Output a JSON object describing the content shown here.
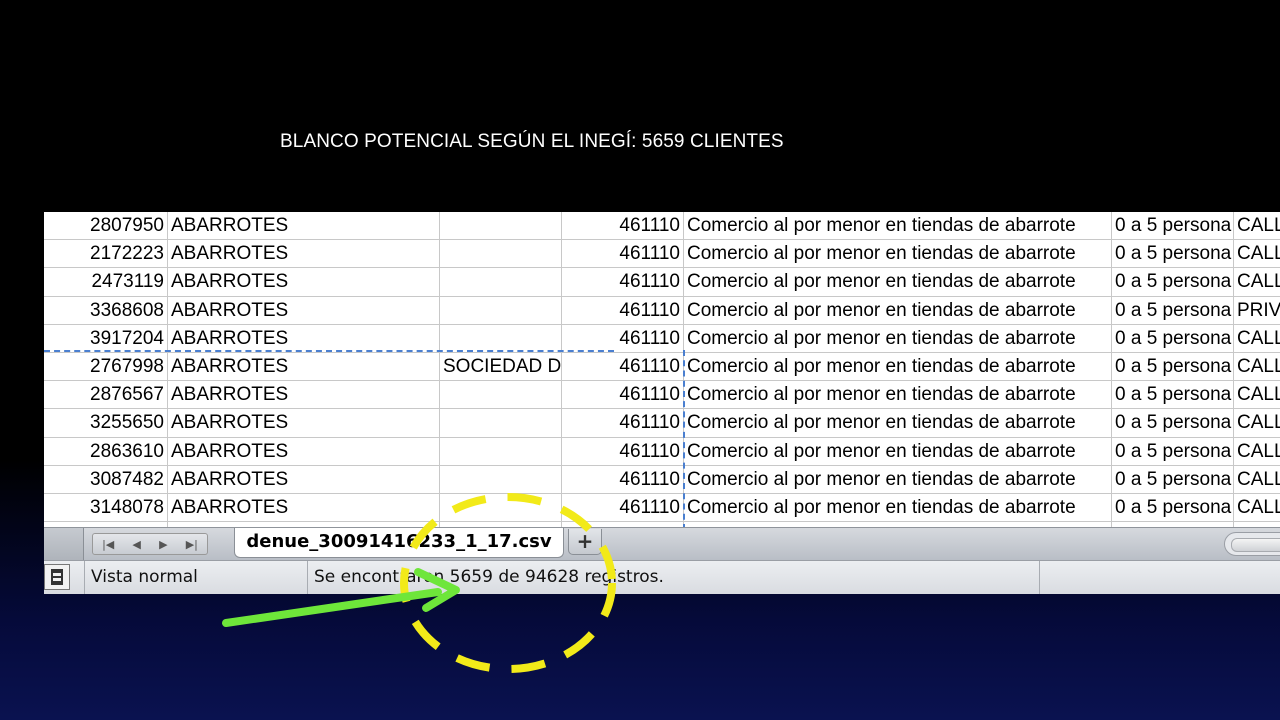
{
  "slide": {
    "title": "BLANCO POTENCIAL SEGÚN EL INEGÍ: 5659 CLIENTES"
  },
  "spreadsheet": {
    "rows": [
      {
        "id": "2807950",
        "name": "ABARROTES",
        "company": "",
        "code": "461110",
        "activity": "Comercio al por menor en tiendas de abarrote",
        "employees": "0 a 5 persona",
        "road": "CALL"
      },
      {
        "id": "2172223",
        "name": "ABARROTES",
        "company": "",
        "code": "461110",
        "activity": "Comercio al por menor en tiendas de abarrote",
        "employees": "0 a 5 persona",
        "road": "CALL"
      },
      {
        "id": "2473119",
        "name": "ABARROTES",
        "company": "",
        "code": "461110",
        "activity": "Comercio al por menor en tiendas de abarrote",
        "employees": "0 a 5 persona",
        "road": "CALL"
      },
      {
        "id": "3368608",
        "name": "ABARROTES",
        "company": "",
        "code": "461110",
        "activity": "Comercio al por menor en tiendas de abarrote",
        "employees": "0 a 5 persona",
        "road": "PRIV"
      },
      {
        "id": "3917204",
        "name": "ABARROTES",
        "company": "",
        "code": "461110",
        "activity": "Comercio al por menor en tiendas de abarrote",
        "employees": "0 a 5 persona",
        "road": "CALL"
      },
      {
        "id": "2767998",
        "name": "ABARROTES",
        "company": "SOCIEDAD DI",
        "code": "461110",
        "activity": "Comercio al por menor en tiendas de abarrote",
        "employees": "0 a 5 persona",
        "road": "CALL"
      },
      {
        "id": "2876567",
        "name": "ABARROTES",
        "company": "",
        "code": "461110",
        "activity": "Comercio al por menor en tiendas de abarrote",
        "employees": "0 a 5 persona",
        "road": "CALL"
      },
      {
        "id": "3255650",
        "name": "ABARROTES",
        "company": "",
        "code": "461110",
        "activity": "Comercio al por menor en tiendas de abarrote",
        "employees": "0 a 5 persona",
        "road": "CALL"
      },
      {
        "id": "2863610",
        "name": "ABARROTES",
        "company": "",
        "code": "461110",
        "activity": "Comercio al por menor en tiendas de abarrote",
        "employees": "0 a 5 persona",
        "road": "CALL"
      },
      {
        "id": "3087482",
        "name": "ABARROTES",
        "company": "",
        "code": "461110",
        "activity": "Comercio al por menor en tiendas de abarrote",
        "employees": "0 a 5 persona",
        "road": "CALL"
      },
      {
        "id": "3148078",
        "name": "ABARROTES",
        "company": "",
        "code": "461110",
        "activity": "Comercio al por menor en tiendas de abarrote",
        "employees": "0 a 5 persona",
        "road": "CALL"
      }
    ],
    "sheet_tab": "denue_30091416233_1_17.csv",
    "add_sheet_label": "+",
    "status": {
      "view_mode": "Vista normal",
      "message": "Se encontraron 5659 de 94628 registros."
    },
    "icons": [
      "sheet-nav-first-icon",
      "sheet-nav-prev-icon",
      "sheet-nav-next-icon",
      "sheet-nav-last-icon",
      "page-layout-icon"
    ]
  },
  "annotation_colors": {
    "circle": "#f2ea19",
    "arrow": "#6ee63a",
    "page_break": "#4a7fd0"
  }
}
